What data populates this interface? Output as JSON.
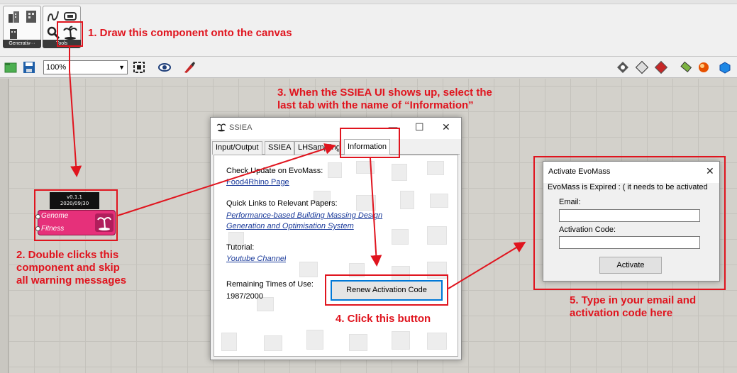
{
  "ribbon": {
    "panel1_caption": "Generativ···",
    "panel2_caption": "Tools"
  },
  "toolbar": {
    "zoom_value": "100%"
  },
  "component": {
    "version": "v0.1.1",
    "date": "2020/09/30",
    "input1": "Genome",
    "input2": "Fitness"
  },
  "ssiea_window": {
    "title": "SSIEA",
    "tabs": [
      "Input/Output",
      "SSIEA",
      "LHSampling",
      "Information"
    ],
    "check_update_label": "Check Update on EvoMass:",
    "food4rhino_link": "Food4Rhino Page",
    "quick_links_label": "Quick Links to Relevant Papers:",
    "paper_link_line1": "Performance-based Building Massing Design",
    "paper_link_line2": "Generation and Optimisation System",
    "tutorial_label": "Tutorial:",
    "youtube_link": "Youtube Channel",
    "remaining_label": "Remaining Times of Use:",
    "remaining_value": "1987/2000",
    "renew_button": "Renew Activation Code"
  },
  "activate_window": {
    "title": "Activate EvoMass",
    "message": "EvoMass is Expired : (  it needs to be activated",
    "email_label": "Email:",
    "code_label": "Activation Code:",
    "activate_button": "Activate"
  },
  "annotations": {
    "step1": "1. Draw this component onto the canvas",
    "step2_line1": "2. Double clicks this",
    "step2_line2": "component and skip",
    "step2_line3": "all warning messages",
    "step3_line1": "3. When the SSIEA UI shows up, select the",
    "step3_line2": "last tab with the name of  “Information”",
    "step4": "4. Click this button",
    "step5_line1": "5. Type in your email and",
    "step5_line2": " activation code here",
    "color": "#e0141e"
  },
  "colors": {
    "component_pink": "#e6307a",
    "canvas": "#d3d1cb",
    "link_blue": "#1a3a9a"
  }
}
